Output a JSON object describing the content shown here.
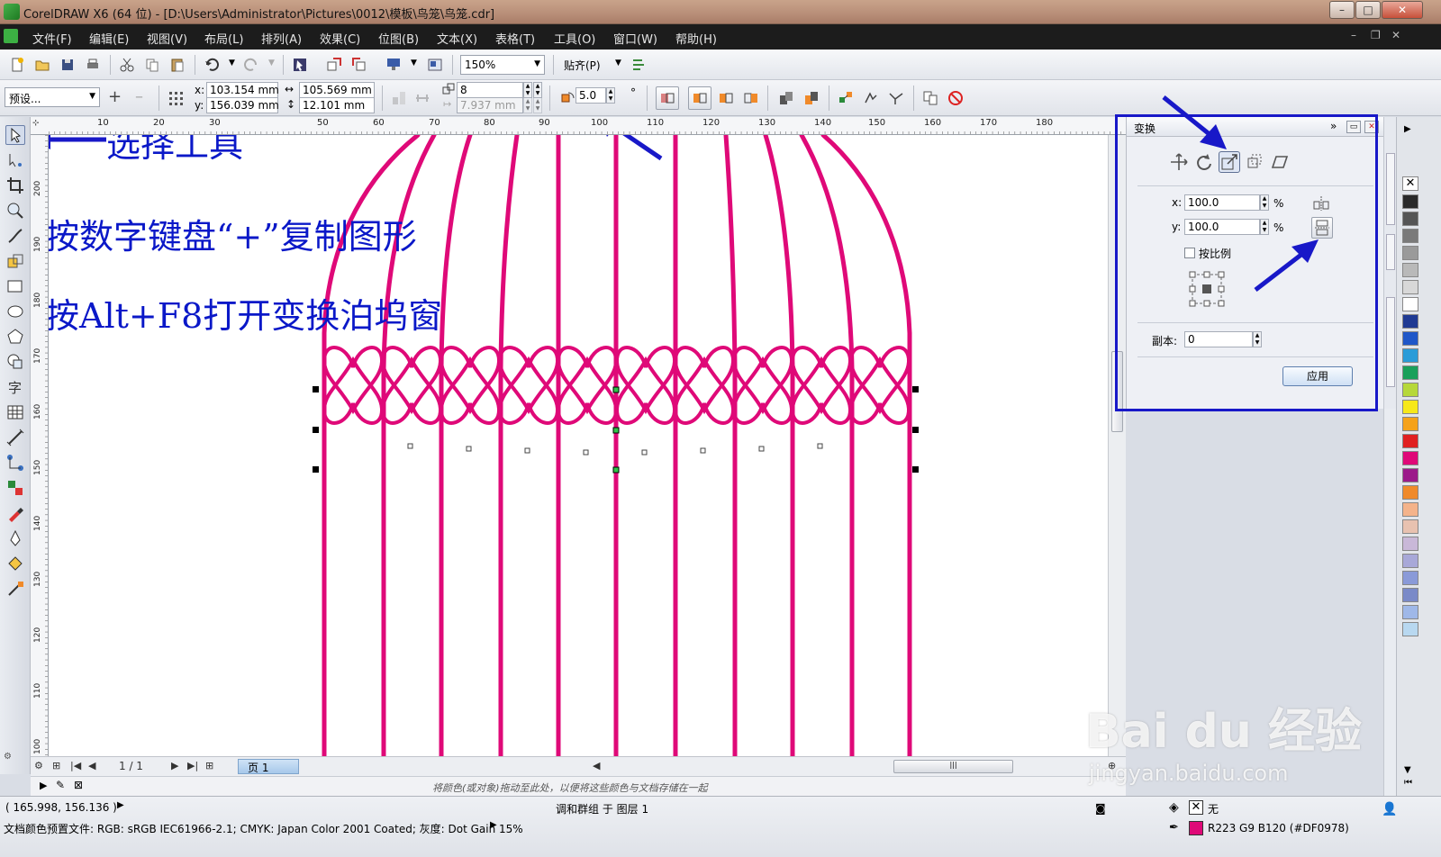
{
  "window": {
    "title": "CorelDRAW X6 (64 位) - [D:\\Users\\Administrator\\Pictures\\0012\\模板\\鸟笼\\鸟笼.cdr]"
  },
  "menu": [
    "文件(F)",
    "编辑(E)",
    "视图(V)",
    "布局(L)",
    "排列(A)",
    "效果(C)",
    "位图(B)",
    "文本(X)",
    "表格(T)",
    "工具(O)",
    "窗口(W)",
    "帮助(H)"
  ],
  "standard_toolbar": {
    "zoom": "150%",
    "snap": "贴齐(P)"
  },
  "property_bar": {
    "preset": "预设...",
    "x_label": "x:",
    "x": "103.154 mm",
    "y_label": "y:",
    "y": "156.039 mm",
    "width": "105.569 mm",
    "height": "12.101 mm",
    "steps": "8",
    "spacing": "7.937 mm",
    "rotation": "5.0",
    "degree": "°"
  },
  "rulers": {
    "horizontal": [
      "10",
      "20",
      "30",
      "50",
      "60",
      "70",
      "80",
      "90",
      "100",
      "110",
      "120",
      "130",
      "140",
      "150",
      "160",
      "170",
      "180"
    ],
    "vertical": [
      "200",
      "190",
      "180",
      "170",
      "160",
      "150",
      "140",
      "130",
      "120",
      "110",
      "100"
    ]
  },
  "annotations": {
    "select_tool": "选择工具",
    "copy_hint": "按数字键盘“+”复制图形",
    "transform_hint": "按Alt+F8打开变换泊坞窗"
  },
  "docker": {
    "title": "变换",
    "x_label": "x:",
    "x_value": "100.0",
    "y_label": "y:",
    "y_value": "100.0",
    "percent": "%",
    "proportional": "按比例",
    "copies_label": "副本:",
    "copies_value": "0",
    "apply": "应用"
  },
  "page_nav": {
    "count": "1 / 1",
    "page_tab": "页 1"
  },
  "doc_palette_hint": "将颜色(或对象)拖动至此处，以便将这些颜色与文档存储在一起",
  "status": {
    "coords": "( 165.998, 156.136 )",
    "object": "调和群组 于 图层 1",
    "color_profile": "文档颜色预置文件: RGB: sRGB IEC61966-2.1; CMYK: Japan Color 2001 Coated; 灰度: Dot Gain 15%",
    "fill": "无",
    "outline": "R223 G9 B120 (#DF0978)"
  },
  "watermark": {
    "brand": "Bai du 经验",
    "url": "jingyan.baidu.com"
  },
  "colors": {
    "shape": "#DF0978",
    "annotation": "#0A18C8",
    "palette": [
      "#2a2a2a",
      "#555555",
      "#7a7a7a",
      "#9a9a9a",
      "#b9b9b9",
      "#d8d8d8",
      "#ffffff",
      "#1f3a93",
      "#1f57c8",
      "#2a9cd8",
      "#1aa05a",
      "#b6d83a",
      "#f7e81a",
      "#f5a21a",
      "#e02020",
      "#df0978",
      "#9c1a8a",
      "#f08a2a",
      "#f4b38a",
      "#e8c2b0",
      "#c9b8d8",
      "#a8a8d8",
      "#8a9ad8",
      "#7a8ac8",
      "#9fb8e8",
      "#b8d8f0"
    ]
  }
}
